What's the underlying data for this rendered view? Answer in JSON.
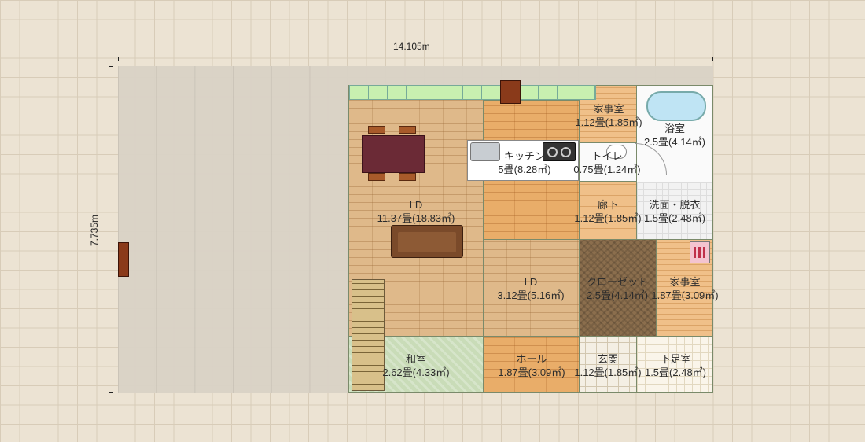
{
  "dimensions": {
    "width_label": "14.105m",
    "height_label": "7.735m"
  },
  "rooms": {
    "ld_main": {
      "name": "LD",
      "area": "11.37畳(18.83㎡)"
    },
    "kitchen": {
      "name": "キッチン",
      "area": "5畳(8.28㎡)"
    },
    "utility1": {
      "name": "家事室",
      "area": "1.12畳(1.85㎡)"
    },
    "bath": {
      "name": "浴室",
      "area": "2.5畳(4.14㎡)"
    },
    "toilet": {
      "name": "トイレ",
      "area": "0.75畳(1.24㎡)"
    },
    "hallway": {
      "name": "廊下",
      "area": "1.12畳(1.85㎡)"
    },
    "washroom": {
      "name": "洗面・脱衣",
      "area": "1.5畳(2.48㎡)"
    },
    "ld_small": {
      "name": "LD",
      "area": "3.12畳(5.16㎡)"
    },
    "closet": {
      "name": "クローゼット",
      "area": "2.5畳(4.14㎡)"
    },
    "utility2": {
      "name": "家事室",
      "area": "1.87畳(3.09㎡)"
    },
    "washitsu": {
      "name": "和室",
      "area": "2.62畳(4.33㎡)"
    },
    "hall": {
      "name": "ホール",
      "area": "1.87畳(3.09㎡)"
    },
    "entrance": {
      "name": "玄関",
      "area": "1.12畳(1.85㎡)"
    },
    "shoe_room": {
      "name": "下足室",
      "area": "1.5畳(2.48㎡)"
    }
  }
}
